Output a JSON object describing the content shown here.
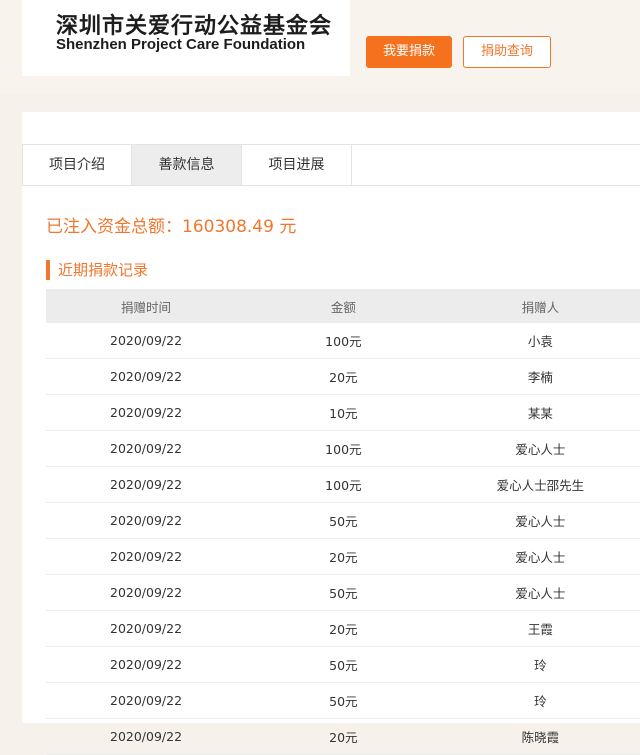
{
  "header": {
    "logo_cn": "深圳市关爱行动公益基金会",
    "logo_en": "Shenzhen Project Care Foundation",
    "donate_button": "我要捐款",
    "query_button": "捐助查询"
  },
  "tabs": [
    {
      "label": "项目介绍",
      "active": false
    },
    {
      "label": "善款信息",
      "active": true
    },
    {
      "label": "项目进展",
      "active": false
    }
  ],
  "funds": {
    "total_text": "已注入资金总额：160308.49 元"
  },
  "records": {
    "title": "近期捐款记录",
    "columns": [
      "捐赠时间",
      "金额",
      "捐赠人"
    ],
    "rows": [
      [
        "2020/09/22",
        "100元",
        "小袁"
      ],
      [
        "2020/09/22",
        "20元",
        "李楠"
      ],
      [
        "2020/09/22",
        "10元",
        "某某"
      ],
      [
        "2020/09/22",
        "100元",
        "爱心人士"
      ],
      [
        "2020/09/22",
        "100元",
        "爱心人士邵先生"
      ],
      [
        "2020/09/22",
        "50元",
        "爱心人士"
      ],
      [
        "2020/09/22",
        "20元",
        "爱心人士"
      ],
      [
        "2020/09/22",
        "50元",
        "爱心人士"
      ],
      [
        "2020/09/22",
        "20元",
        "王霞"
      ],
      [
        "2020/09/22",
        "50元",
        "玲"
      ],
      [
        "2020/09/22",
        "50元",
        "玲"
      ],
      [
        "2020/09/22",
        "20元",
        "陈晓霞"
      ]
    ]
  },
  "colors": {
    "accent": "#f5711d",
    "background": "#f6f1ea",
    "table_header": "#ececec"
  }
}
